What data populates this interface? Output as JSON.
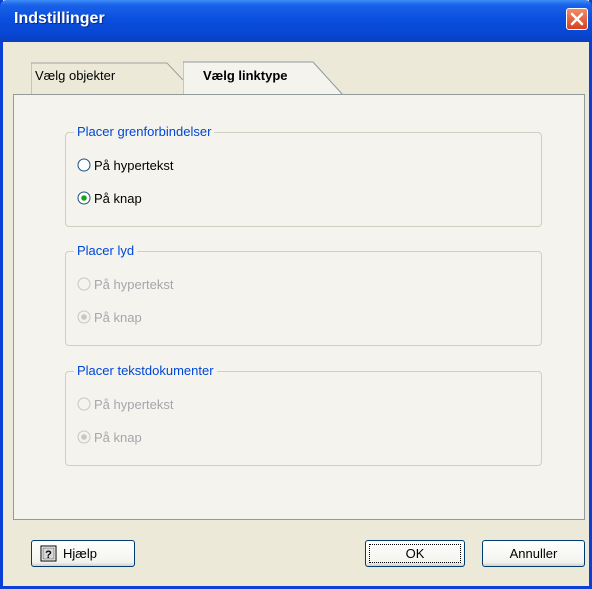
{
  "window": {
    "title": "Indstillinger",
    "close_icon": "close-icon"
  },
  "tabs": [
    {
      "label": "Vælg objekter",
      "selected": false
    },
    {
      "label": "Vælg linktype",
      "selected": true
    }
  ],
  "groups": [
    {
      "label": "Placer grenforbindelser",
      "enabled": true,
      "options": [
        {
          "label": "På hypertekst",
          "checked": false
        },
        {
          "label": "På knap",
          "checked": true
        }
      ]
    },
    {
      "label": "Placer lyd",
      "enabled": false,
      "options": [
        {
          "label": "På hypertekst",
          "checked": false
        },
        {
          "label": "På knap",
          "checked": true
        }
      ]
    },
    {
      "label": "Placer tekstdokumenter",
      "enabled": false,
      "options": [
        {
          "label": "På hypertekst",
          "checked": false
        },
        {
          "label": "På knap",
          "checked": true
        }
      ]
    }
  ],
  "buttons": {
    "help": "Hjælp",
    "help_icon": "help-icon",
    "ok": "OK",
    "cancel": "Annuller"
  },
  "colors": {
    "titlebar": "#0a4fde",
    "group_label": "#0046d5",
    "disabled_text": "#a7a6aa",
    "close_button": "#d8411f"
  }
}
